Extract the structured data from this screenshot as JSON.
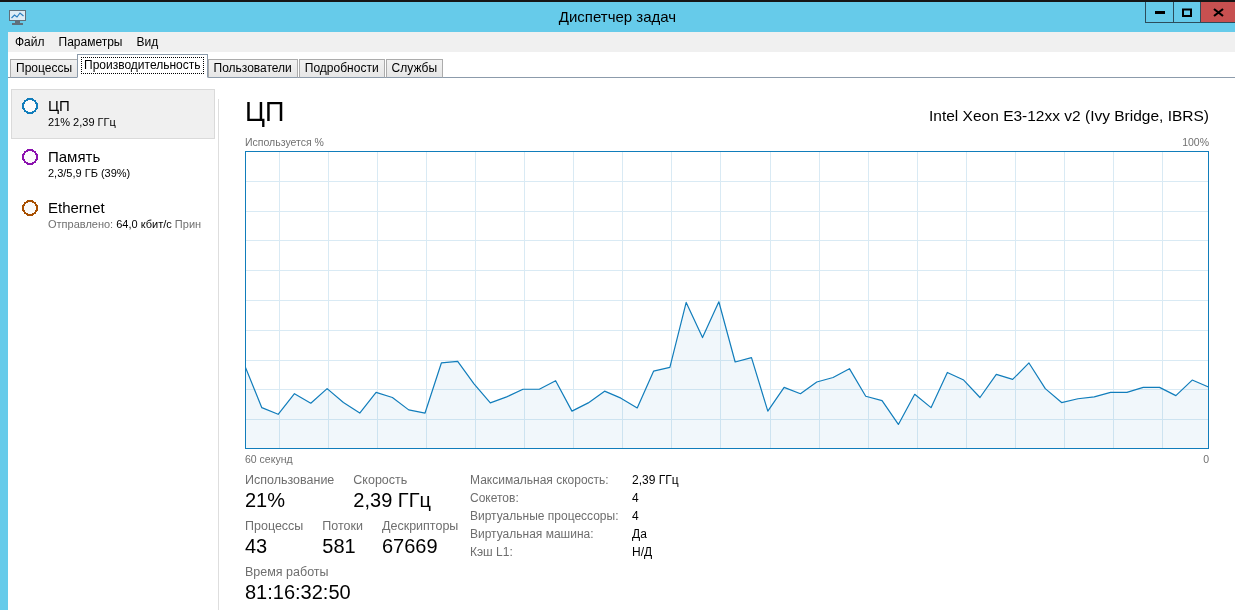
{
  "window": {
    "title": "Диспетчер задач"
  },
  "menu": [
    {
      "label": "Файл"
    },
    {
      "label": "Параметры"
    },
    {
      "label": "Вид"
    }
  ],
  "tabs": [
    {
      "label": "Процессы",
      "selected": false
    },
    {
      "label": "Производительность",
      "selected": true
    },
    {
      "label": "Пользователи",
      "selected": false
    },
    {
      "label": "Подробности",
      "selected": false
    },
    {
      "label": "Службы",
      "selected": false
    }
  ],
  "sidebar": {
    "items": [
      {
        "name": "ЦП",
        "color": "#117dbb",
        "selected": true,
        "detail": [
          {
            "text": "21%",
            "kind": "value"
          },
          {
            "text": "2,39 ГГц",
            "kind": "value"
          }
        ]
      },
      {
        "name": "Память",
        "color": "#8b12ae",
        "selected": false,
        "detail": [
          {
            "text": "2,3/5,9 ГБ (39%)",
            "kind": "value"
          }
        ]
      },
      {
        "name": "Ethernet",
        "color": "#a74f01",
        "selected": false,
        "detail": [
          {
            "text": "Отправлено:",
            "kind": "label"
          },
          {
            "text": "64,0 кбит/с",
            "kind": "value"
          },
          {
            "text": "Прин",
            "kind": "label"
          }
        ]
      }
    ]
  },
  "panel": {
    "title": "ЦП",
    "device": "Intel Xeon E3-12xx v2 (Ivy Bridge, IBRS)",
    "chart_data": {
      "type": "area",
      "ylabel": "Используется %",
      "xlabel": "60 секунд",
      "grid": true,
      "ylim": [
        0,
        100
      ],
      "yticks": [
        {
          "value": 100,
          "label": "100%"
        },
        {
          "value": 0,
          "label": "0"
        }
      ],
      "categories": [
        null,
        null,
        null,
        null,
        null,
        null,
        null,
        null,
        null,
        null,
        null,
        null,
        null,
        null,
        null,
        null,
        null,
        null,
        null,
        null,
        null,
        null,
        null,
        null,
        null,
        null,
        null,
        null,
        null,
        null,
        null,
        null,
        null,
        null,
        null,
        null,
        null,
        null,
        null,
        null,
        null,
        null,
        null,
        null,
        null,
        null,
        null,
        null,
        null,
        null,
        null,
        null,
        null,
        null,
        null,
        null,
        null,
        null,
        null,
        null
      ],
      "values": [
        28.9,
        16.2,
        14.1,
        20.6,
        17.6,
        22.2,
        17.8,
        14.5,
        21.0,
        19.4,
        15.5,
        14.5,
        30.3,
        30.8,
        23.7,
        17.7,
        19.6,
        22.0,
        22.0,
        24.7,
        15.1,
        17.7,
        21.4,
        19.2,
        16.1,
        27.7,
        28.9,
        49.4,
        38.3,
        49.6,
        30.6,
        32.0,
        15.1,
        22.6,
        20.6,
        24.3,
        25.7,
        28.5,
        19.8,
        18.4,
        10.9,
        20.4,
        16.2,
        27.3,
        24.9,
        19.4,
        26.7,
        25.1,
        30.3,
        22.2,
        17.8,
        19.0,
        19.6,
        21.0,
        21.0,
        22.6,
        22.6,
        20.0,
        24.9,
        22.7
      ]
    },
    "stat_rows": [
      [
        {
          "label": "Использование",
          "value": "21%"
        },
        {
          "label": "Скорость",
          "value": "2,39 ГГц"
        }
      ],
      [
        {
          "label": "Процессы",
          "value": "43"
        },
        {
          "label": "Потоки",
          "value": "581"
        },
        {
          "label": "Дескрипторы",
          "value": "67669"
        }
      ],
      [
        {
          "label": "Время работы",
          "value": "81:16:32:50"
        }
      ]
    ],
    "details": [
      {
        "label": "Максимальная скорость:",
        "value": "2,39 ГГц"
      },
      {
        "label": "Сокетов:",
        "value": "4"
      },
      {
        "label": "Виртуальные процессоры:",
        "value": "4"
      },
      {
        "label": "Виртуальная машина:",
        "value": "Да"
      },
      {
        "label": "Кэш L1:",
        "value": "Н/Д"
      }
    ]
  }
}
